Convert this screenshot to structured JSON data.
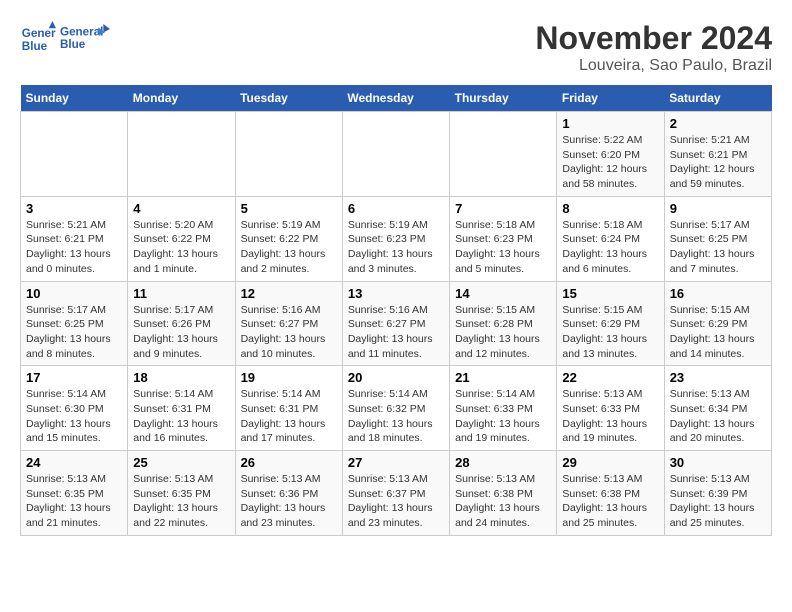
{
  "logo": {
    "line1": "General",
    "line2": "Blue"
  },
  "title": "November 2024",
  "subtitle": "Louveira, Sao Paulo, Brazil",
  "weekdays": [
    "Sunday",
    "Monday",
    "Tuesday",
    "Wednesday",
    "Thursday",
    "Friday",
    "Saturday"
  ],
  "weeks": [
    [
      {
        "day": "",
        "detail": ""
      },
      {
        "day": "",
        "detail": ""
      },
      {
        "day": "",
        "detail": ""
      },
      {
        "day": "",
        "detail": ""
      },
      {
        "day": "",
        "detail": ""
      },
      {
        "day": "1",
        "detail": "Sunrise: 5:22 AM\nSunset: 6:20 PM\nDaylight: 12 hours and 58 minutes."
      },
      {
        "day": "2",
        "detail": "Sunrise: 5:21 AM\nSunset: 6:21 PM\nDaylight: 12 hours and 59 minutes."
      }
    ],
    [
      {
        "day": "3",
        "detail": "Sunrise: 5:21 AM\nSunset: 6:21 PM\nDaylight: 13 hours and 0 minutes."
      },
      {
        "day": "4",
        "detail": "Sunrise: 5:20 AM\nSunset: 6:22 PM\nDaylight: 13 hours and 1 minute."
      },
      {
        "day": "5",
        "detail": "Sunrise: 5:19 AM\nSunset: 6:22 PM\nDaylight: 13 hours and 2 minutes."
      },
      {
        "day": "6",
        "detail": "Sunrise: 5:19 AM\nSunset: 6:23 PM\nDaylight: 13 hours and 3 minutes."
      },
      {
        "day": "7",
        "detail": "Sunrise: 5:18 AM\nSunset: 6:23 PM\nDaylight: 13 hours and 5 minutes."
      },
      {
        "day": "8",
        "detail": "Sunrise: 5:18 AM\nSunset: 6:24 PM\nDaylight: 13 hours and 6 minutes."
      },
      {
        "day": "9",
        "detail": "Sunrise: 5:17 AM\nSunset: 6:25 PM\nDaylight: 13 hours and 7 minutes."
      }
    ],
    [
      {
        "day": "10",
        "detail": "Sunrise: 5:17 AM\nSunset: 6:25 PM\nDaylight: 13 hours and 8 minutes."
      },
      {
        "day": "11",
        "detail": "Sunrise: 5:17 AM\nSunset: 6:26 PM\nDaylight: 13 hours and 9 minutes."
      },
      {
        "day": "12",
        "detail": "Sunrise: 5:16 AM\nSunset: 6:27 PM\nDaylight: 13 hours and 10 minutes."
      },
      {
        "day": "13",
        "detail": "Sunrise: 5:16 AM\nSunset: 6:27 PM\nDaylight: 13 hours and 11 minutes."
      },
      {
        "day": "14",
        "detail": "Sunrise: 5:15 AM\nSunset: 6:28 PM\nDaylight: 13 hours and 12 minutes."
      },
      {
        "day": "15",
        "detail": "Sunrise: 5:15 AM\nSunset: 6:29 PM\nDaylight: 13 hours and 13 minutes."
      },
      {
        "day": "16",
        "detail": "Sunrise: 5:15 AM\nSunset: 6:29 PM\nDaylight: 13 hours and 14 minutes."
      }
    ],
    [
      {
        "day": "17",
        "detail": "Sunrise: 5:14 AM\nSunset: 6:30 PM\nDaylight: 13 hours and 15 minutes."
      },
      {
        "day": "18",
        "detail": "Sunrise: 5:14 AM\nSunset: 6:31 PM\nDaylight: 13 hours and 16 minutes."
      },
      {
        "day": "19",
        "detail": "Sunrise: 5:14 AM\nSunset: 6:31 PM\nDaylight: 13 hours and 17 minutes."
      },
      {
        "day": "20",
        "detail": "Sunrise: 5:14 AM\nSunset: 6:32 PM\nDaylight: 13 hours and 18 minutes."
      },
      {
        "day": "21",
        "detail": "Sunrise: 5:14 AM\nSunset: 6:33 PM\nDaylight: 13 hours and 19 minutes."
      },
      {
        "day": "22",
        "detail": "Sunrise: 5:13 AM\nSunset: 6:33 PM\nDaylight: 13 hours and 19 minutes."
      },
      {
        "day": "23",
        "detail": "Sunrise: 5:13 AM\nSunset: 6:34 PM\nDaylight: 13 hours and 20 minutes."
      }
    ],
    [
      {
        "day": "24",
        "detail": "Sunrise: 5:13 AM\nSunset: 6:35 PM\nDaylight: 13 hours and 21 minutes."
      },
      {
        "day": "25",
        "detail": "Sunrise: 5:13 AM\nSunset: 6:35 PM\nDaylight: 13 hours and 22 minutes."
      },
      {
        "day": "26",
        "detail": "Sunrise: 5:13 AM\nSunset: 6:36 PM\nDaylight: 13 hours and 23 minutes."
      },
      {
        "day": "27",
        "detail": "Sunrise: 5:13 AM\nSunset: 6:37 PM\nDaylight: 13 hours and 23 minutes."
      },
      {
        "day": "28",
        "detail": "Sunrise: 5:13 AM\nSunset: 6:38 PM\nDaylight: 13 hours and 24 minutes."
      },
      {
        "day": "29",
        "detail": "Sunrise: 5:13 AM\nSunset: 6:38 PM\nDaylight: 13 hours and 25 minutes."
      },
      {
        "day": "30",
        "detail": "Sunrise: 5:13 AM\nSunset: 6:39 PM\nDaylight: 13 hours and 25 minutes."
      }
    ]
  ]
}
